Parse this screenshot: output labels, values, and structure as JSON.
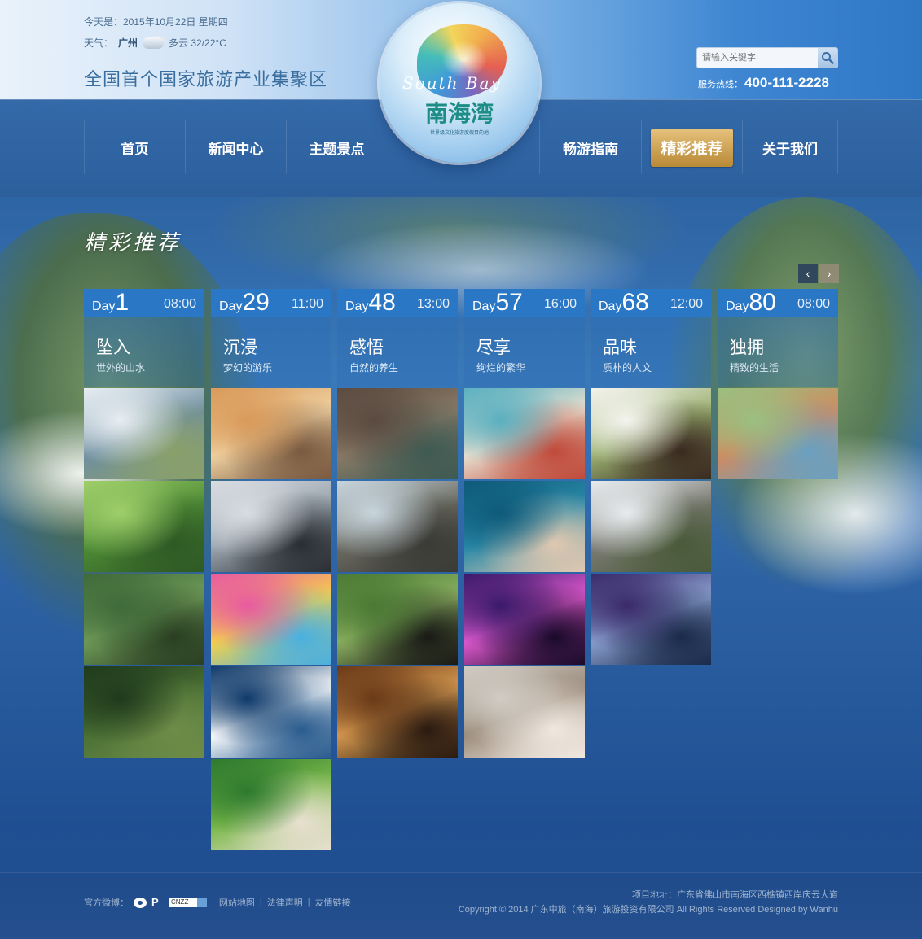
{
  "header": {
    "date": "今天是：2015年10月22日 星期四",
    "weather_prefix": "天气：",
    "city": "广州",
    "weather_desc": "多云 32/22°C",
    "slogan": "全国首个国家旅游产业集聚区",
    "search_placeholder": "请输入关键字",
    "hotline_label": "服务热线：",
    "hotline_number": "400-111-2228"
  },
  "logo": {
    "script": "South Bay",
    "title": "南海湾",
    "sub": "世界级文化旅游度假目的地"
  },
  "nav": {
    "items": [
      "首页",
      "新闻中心",
      "主题景点",
      "畅游指南",
      "精彩推荐",
      "关于我们"
    ],
    "active_index": 4
  },
  "section": {
    "title": "精彩推荐",
    "prev_arrow": "‹",
    "next_arrow": "›"
  },
  "columns": [
    {
      "day_label": "Day",
      "day_num": "1",
      "time": "08:00",
      "title": "坠入",
      "subtitle": "世外的山水"
    },
    {
      "day_label": "Day",
      "day_num": "29",
      "time": "11:00",
      "title": "沉浸",
      "subtitle": "梦幻的游乐"
    },
    {
      "day_label": "Day",
      "day_num": "48",
      "time": "13:00",
      "title": "感悟",
      "subtitle": "自然的养生"
    },
    {
      "day_label": "Day",
      "day_num": "57",
      "time": "16:00",
      "title": "尽享",
      "subtitle": "绚烂的繁华"
    },
    {
      "day_label": "Day",
      "day_num": "68",
      "time": "12:00",
      "title": "品味",
      "subtitle": "质朴的人文"
    },
    {
      "day_label": "Day",
      "day_num": "80",
      "time": "08:00",
      "title": "独拥",
      "subtitle": "精致的生活"
    }
  ],
  "footer": {
    "weibo_label": "官方微博：",
    "links": [
      "网站地图",
      "法律声明",
      "友情链接"
    ],
    "badge": "CNZZ",
    "address": "项目地址：广东省佛山市南海区西樵镇西岸庆云大道",
    "copyright": "Copyright © 2014 广东中旅（南海）旅游投资有限公司 All Rights Reserved Designed by Wanhu"
  },
  "colors": {
    "accent_gold": "#c99a4a",
    "day_header": "#2a77c6",
    "nav_bg": "#2f63a2"
  }
}
